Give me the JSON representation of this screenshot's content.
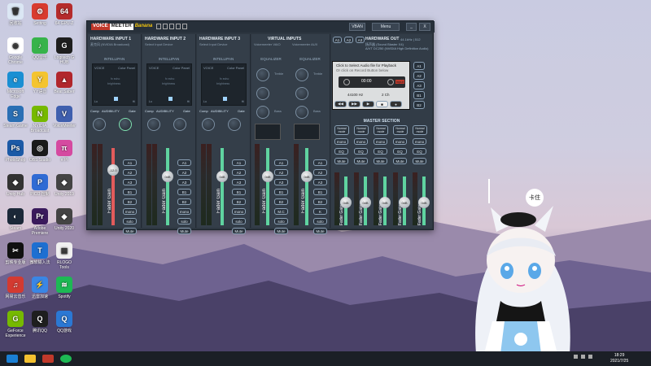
{
  "desktop": {
    "icons": [
      {
        "label": "回收站",
        "color": "#dbe7f4",
        "glyph": "🗑"
      },
      {
        "label": "Setting",
        "color": "#d83b2f",
        "glyph": "⚙"
      },
      {
        "label": "64 GPU-Z",
        "color": "#b52b2b",
        "glyph": "64"
      },
      {
        "label": "Google Chrome",
        "color": "#ffffff",
        "glyph": "◉"
      },
      {
        "label": "QQ音乐",
        "color": "#37b34a",
        "glyph": "♪"
      },
      {
        "label": "Logitech G HUB",
        "color": "#1e1e1e",
        "glyph": "G"
      },
      {
        "label": "Microsoft Edge",
        "color": "#1b8fd3",
        "glyph": "e"
      },
      {
        "label": "YY语音",
        "color": "#f4c430",
        "glyph": "Y"
      },
      {
        "label": "Beat Saber",
        "color": "#b1262c",
        "glyph": "▲"
      },
      {
        "label": "Steam Game",
        "color": "#2a6fb4",
        "glyph": "S"
      },
      {
        "label": "NVIDIA Broadcast",
        "color": "#76b900",
        "glyph": "N"
      },
      {
        "label": "VoiceMeeter",
        "color": "#3f5fae",
        "glyph": "V"
      },
      {
        "label": "PhotoShop",
        "color": "#1b5aa6",
        "glyph": "Ps"
      },
      {
        "label": "OBS Studio",
        "color": "#1a1a1a",
        "glyph": "◎"
      },
      {
        "label": "π Pi",
        "color": "#d54aa0",
        "glyph": "π"
      },
      {
        "label": "Unity Hub",
        "color": "#333333",
        "glyph": "◆"
      },
      {
        "label": "PICO 控制",
        "color": "#2f6bd4",
        "glyph": "P"
      },
      {
        "label": "Unity 2019",
        "color": "#444444",
        "glyph": "◆"
      },
      {
        "label": "Steam",
        "color": "#1b2838",
        "glyph": "◐"
      },
      {
        "label": "Adobe Premiere",
        "color": "#3a1a5c",
        "glyph": "Pr"
      },
      {
        "label": "Unity 2020",
        "color": "#444444",
        "glyph": "◆"
      },
      {
        "label": "剪映专业版",
        "color": "#111111",
        "glyph": "✂"
      },
      {
        "label": "微软输入法",
        "color": "#1d6fd1",
        "glyph": "T"
      },
      {
        "label": "RLOGO Tools",
        "color": "#f0f0f0",
        "glyph": "▤"
      },
      {
        "label": "网易云音乐",
        "color": "#d33a31",
        "glyph": "♫"
      },
      {
        "label": "迅雷加速",
        "color": "#3a86e5",
        "glyph": "⚡"
      },
      {
        "label": "Spotify",
        "color": "#1db954",
        "glyph": "≋"
      },
      {
        "label": "GeForce Experience",
        "color": "#76b900",
        "glyph": "G"
      },
      {
        "label": "腾讯QQ",
        "color": "#1e1e1e",
        "glyph": "Q"
      },
      {
        "label": "QQ游戏",
        "color": "#2b78d4",
        "glyph": "Q"
      }
    ]
  },
  "voicemeeter": {
    "logo_1": "VOICE",
    "logo_2": "MEETER",
    "logo_3": "Banana",
    "btn_vban": "VBAN",
    "btn_menu": "Menu",
    "btn_min": "_",
    "btn_close": "X",
    "hw_inputs": [
      {
        "title": "HARDWARE INPUT 1",
        "device": "麦克风 (NVIDIA Broadcast)",
        "intel": "INTELLIPAN",
        "voice": "VOICE",
        "color_panel": "Color Panel",
        "fx_echo": "fx echo",
        "brightness": "brightness",
        "lo": "Lo",
        "hi": "Hi",
        "comp": "Comp",
        "audibility": "AUDIBILITY",
        "gate": "Gate",
        "fader_label": "Fader Gain",
        "gain": "-12.0"
      },
      {
        "title": "HARDWARE INPUT 2",
        "device": "Select Input Device",
        "intel": "INTELLIPAN",
        "voice": "VOICE",
        "color_panel": "Color Panel",
        "fx_echo": "fx echo",
        "brightness": "brightness",
        "lo": "Lo",
        "hi": "Hi",
        "comp": "Comp",
        "audibility": "AUDIBILITY",
        "gate": "Gate",
        "fader_label": "Fader Gain",
        "gain": "0dB"
      },
      {
        "title": "HARDWARE INPUT 3",
        "device": "Select Input Device",
        "intel": "INTELLIPAN",
        "voice": "VOICE",
        "color_panel": "Color Panel",
        "fx_echo": "fx echo",
        "brightness": "brightness",
        "lo": "Lo",
        "hi": "Hi",
        "comp": "Comp",
        "audibility": "AUDIBILITY",
        "gate": "Gate",
        "fader_label": "Fader Gain",
        "gain": "0dB"
      }
    ],
    "virtual": {
      "title": "VIRTUAL INPUTS",
      "vaio": "Voicemeeter VAIO",
      "aux": "Voicemeeter AUX",
      "equalizer": "EQUALIZER",
      "treble": "Treble",
      "bass": "Bass",
      "fader_label": "Fader Gain",
      "gain": "0dB"
    },
    "strip_buttons": [
      "A1",
      "A2",
      "A3",
      "B1",
      "B2",
      "mono",
      "solo",
      "Mute"
    ],
    "virtual_buttons": [
      "A1",
      "A2",
      "A3",
      "B1",
      "B2",
      "M.C",
      "solo",
      "Mute"
    ],
    "virtual_buttons_2": [
      "A1",
      "A2",
      "A3",
      "B1",
      "B2",
      "K",
      "solo",
      "Mute"
    ],
    "hw_out": {
      "title": "HARDWARE OUT",
      "rate": "44.1kHz | 512",
      "device1": "扬声器 (Sound Blaster X4)",
      "device2": "A/VT DC250 (NVIDIA High Definition Audio)",
      "a_buttons": [
        "A1",
        "A2",
        "A3"
      ]
    },
    "recorder": {
      "line1": "Click to Select Audio file for Playback",
      "line2": "Or click on Record Button below",
      "time": "00:00",
      "input": "input",
      "rate": "44100 Hz",
      "ch": "2 Ch",
      "outs": [
        "A1",
        "A2",
        "A3",
        "B1",
        "B2"
      ]
    },
    "master": {
      "title": "MASTER SECTION",
      "channels": [
        {
          "mode": "Normal mode",
          "b1": "mono",
          "b2": "EQ",
          "b3": "Mute",
          "gain": "0dB"
        },
        {
          "mode": "Normal mode",
          "b1": "mono",
          "b2": "EQ",
          "b3": "Mute",
          "gain": "0dB"
        },
        {
          "mode": "Normal mode",
          "b1": "mono",
          "b2": "EQ",
          "b3": "Mute",
          "gain": "0dB"
        },
        {
          "mode": "Normal mode",
          "b1": "mono",
          "b2": "EQ",
          "b3": "Mute",
          "gain": "0dB"
        },
        {
          "mode": "Normal mode",
          "b1": "mono",
          "b2": "EQ",
          "b3": "Mute",
          "gain": "0dB"
        }
      ],
      "fader_label": "Fader Gain"
    }
  },
  "taskbar": {
    "time": "18:29",
    "date": "2021/7/25"
  },
  "character": {
    "speech": "卡住"
  }
}
